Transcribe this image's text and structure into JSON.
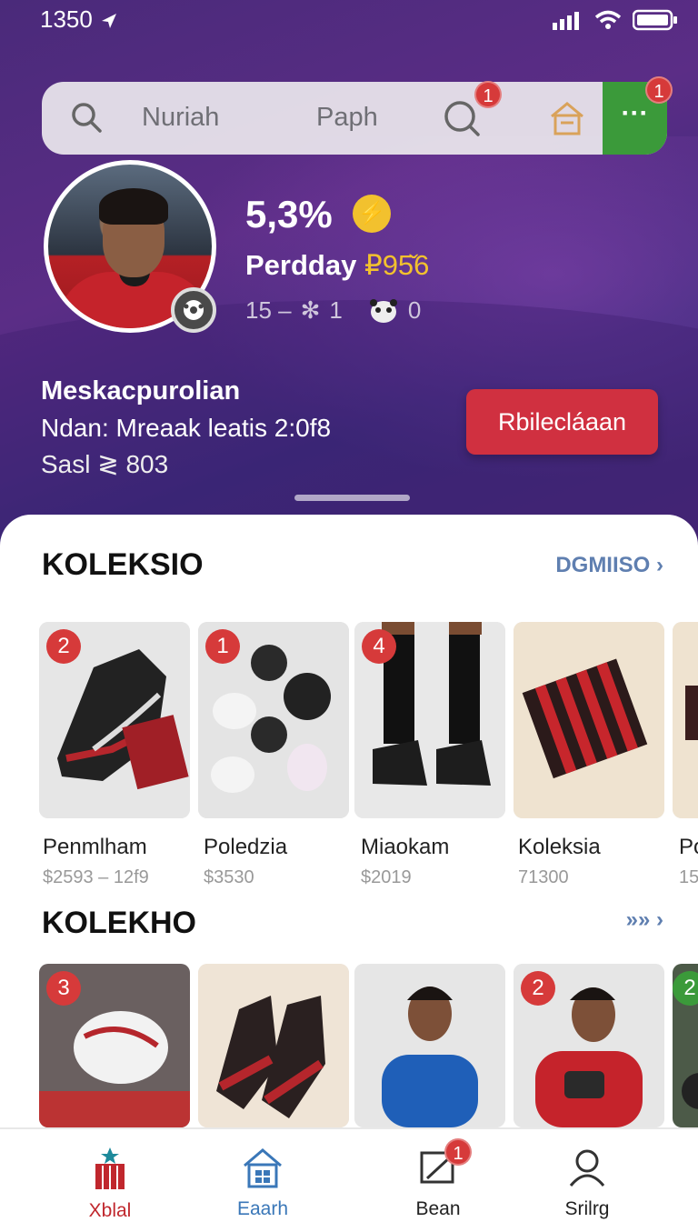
{
  "status_bar": {
    "time": "1350"
  },
  "search": {
    "term1": "Nuriah",
    "term2": "Paph",
    "badge_search": "1",
    "badge_more": "1",
    "more_label": "···"
  },
  "profile": {
    "stat_big": "5,3%",
    "stat_line_label": "Perdday",
    "stat_line_value": "₽95̌6",
    "mini_a": "15 –",
    "mini_b": "1",
    "mini_c": "0",
    "name": "Meskacpurolian",
    "line1": "Ndan: Mreaak leatis 2:0f8",
    "line2": "Sasl ≷ 803",
    "cta": "Rbilecláaan"
  },
  "section1": {
    "title": "KOLEKSIO",
    "link": "DGMIISO",
    "cards": [
      {
        "num": "2",
        "title": "Penmlham",
        "price": "$2593 – 12f9"
      },
      {
        "num": "1",
        "title": "Poledzia",
        "price": "$3530"
      },
      {
        "num": "4",
        "title": "Miaokam",
        "price": "$2019"
      },
      {
        "num": "",
        "title": "Koleksia",
        "price": "71300"
      },
      {
        "num": "",
        "title": "Po",
        "price": "15"
      }
    ]
  },
  "section2": {
    "title": "KOLEKHO",
    "link": "»»",
    "cards": [
      {
        "num": "3"
      },
      {
        "num": ""
      },
      {
        "num": ""
      },
      {
        "num": "2"
      },
      {
        "num": "2"
      }
    ]
  },
  "tabs": [
    {
      "label": "Xblal",
      "color": "#c0272d"
    },
    {
      "label": "Eaarh",
      "color": "#3a77b8"
    },
    {
      "label": "Bean",
      "badge": "1",
      "color": "#222222"
    },
    {
      "label": "Srilrg",
      "color": "#222222"
    }
  ]
}
